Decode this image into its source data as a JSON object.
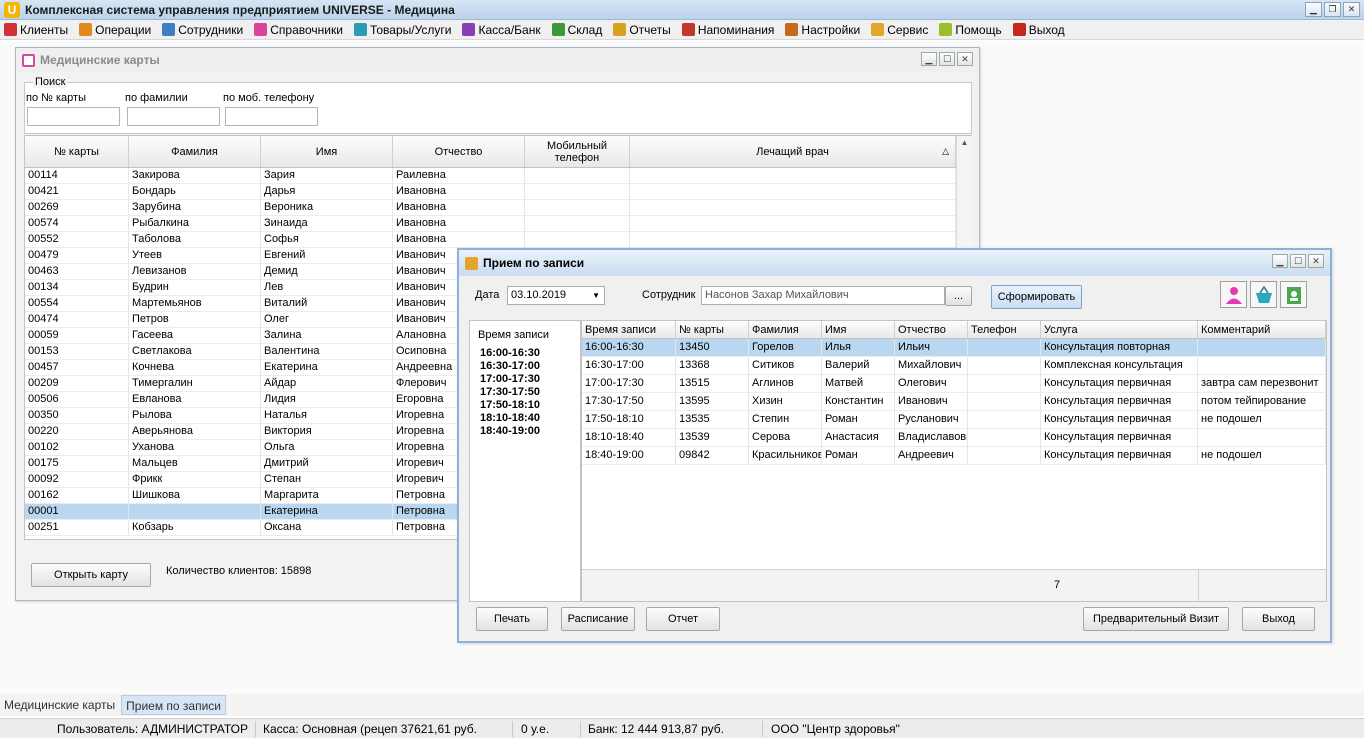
{
  "app": {
    "title": "Комплексная система управления предприятием UNIVERSE - Медицина",
    "logo_letter": "U"
  },
  "menu": [
    {
      "label": "Клиенты",
      "icon": "clients-icon",
      "color": "#d0323a"
    },
    {
      "label": "Операции",
      "icon": "operations-icon",
      "color": "#e08a1e"
    },
    {
      "label": "Сотрудники",
      "icon": "employees-icon",
      "color": "#3f7fc1"
    },
    {
      "label": "Справочники",
      "icon": "references-icon",
      "color": "#d9449a"
    },
    {
      "label": "Товары/Услуги",
      "icon": "goods-icon",
      "color": "#2e9ab5"
    },
    {
      "label": "Касса/Банк",
      "icon": "cash-icon",
      "color": "#8a3fb3"
    },
    {
      "label": "Склад",
      "icon": "warehouse-icon",
      "color": "#3a9a3a"
    },
    {
      "label": "Отчеты",
      "icon": "reports-icon",
      "color": "#d7a21e"
    },
    {
      "label": "Напоминания",
      "icon": "clock-icon",
      "color": "#c0392b"
    },
    {
      "label": "Настройки",
      "icon": "gear-icon",
      "color": "#c56a1a"
    },
    {
      "label": "Сервис",
      "icon": "service-icon",
      "color": "#e0a82a"
    },
    {
      "label": "Помощь",
      "icon": "help-icon",
      "color": "#9bbf2a"
    },
    {
      "label": "Выход",
      "icon": "exit-icon",
      "color": "#c7261f"
    }
  ],
  "cards_window": {
    "title": "Медицинские карты",
    "search": {
      "legend": "Поиск",
      "by_card": "по № карты",
      "by_surname": "по фамилии",
      "by_phone": "по моб. телефону"
    },
    "columns": [
      "№ карты",
      "Фамилия",
      "Имя",
      "Отчество",
      "Мобильный телефон",
      "Лечащий врач"
    ],
    "sort_indicator": "△",
    "rows": [
      [
        "00114",
        "Закирова",
        "Зария",
        "Раилевна"
      ],
      [
        "00421",
        "Бондарь",
        "Дарья",
        "Ивановна"
      ],
      [
        "00269",
        "Зарубина",
        "Вероника",
        "Ивановна"
      ],
      [
        "00574",
        "Рыбалкина",
        "Зинаида",
        "Ивановна"
      ],
      [
        "00552",
        "Таболова",
        "Софья",
        "Ивановна"
      ],
      [
        "00479",
        "Утеев",
        "Евгений",
        "Иванович"
      ],
      [
        "00463",
        "Левизанов",
        "Демид",
        "Иванович"
      ],
      [
        "00134",
        "Будрин",
        "Лев",
        "Иванович"
      ],
      [
        "00554",
        "Мартемьянов",
        "Виталий",
        "Иванович"
      ],
      [
        "00474",
        "Петров",
        "Олег",
        "Иванович"
      ],
      [
        "00059",
        "Гасеева",
        "Залина",
        "Алановна"
      ],
      [
        "00153",
        "Светлакова",
        "Валентина",
        "Осиповна"
      ],
      [
        "00457",
        "Кочнева",
        "Екатерина",
        "Андреевна"
      ],
      [
        "00209",
        "Тимергалин",
        "Айдар",
        "Флерович"
      ],
      [
        "00506",
        "Евланова",
        "Лидия",
        "Егоровна"
      ],
      [
        "00350",
        "Рылова",
        "Наталья",
        "Игоревна"
      ],
      [
        "00220",
        "Аверьянова",
        "Виктория",
        "Игоревна"
      ],
      [
        "00102",
        "Уханова",
        "Ольга",
        "Игоревна"
      ],
      [
        "00175",
        "Мальцев",
        "Дмитрий",
        "Игоревич"
      ],
      [
        "00092",
        "Фрикк",
        "Степан",
        "Игоревич"
      ],
      [
        "00162",
        "Шишкова",
        "Маргарита",
        "Петровна"
      ],
      [
        "00001",
        "",
        "Екатерина",
        "Петровна"
      ],
      [
        "00251",
        "Кобзарь",
        "Оксана",
        "Петровна"
      ]
    ],
    "selected_row": 21,
    "open_button": "Открыть карту",
    "count_label": "Количество клиентов: 15898"
  },
  "appt_window": {
    "title": "Прием по записи",
    "date_label": "Дата",
    "date_value": "03.10.2019",
    "employee_label": "Сотрудник",
    "employee_value": "Насонов Захар Михайлович",
    "browse_label": "...",
    "generate_button": "Сформировать",
    "slots_title": "Время записи",
    "slots": [
      "16:00-16:30",
      "16:30-17:00",
      "17:00-17:30",
      "17:30-17:50",
      "17:50-18:10",
      "18:10-18:40",
      "18:40-19:00"
    ],
    "columns": [
      "Время записи",
      "№ карты",
      "Фамилия",
      "Имя",
      "Отчество",
      "Телефон",
      "Услуга",
      "Комментарий"
    ],
    "rows": [
      [
        "16:00-16:30",
        "13450",
        "Горелов",
        "Илья",
        "Ильич",
        "",
        "Консультация повторная",
        ""
      ],
      [
        "16:30-17:00",
        "13368",
        "Ситиков",
        "Валерий",
        "Михайлович",
        "",
        "Комплексная консультация",
        ""
      ],
      [
        "17:00-17:30",
        "13515",
        "Аглинов",
        "Матвей",
        "Олегович",
        "",
        "Консультация первичная",
        "завтра сам перезвонит"
      ],
      [
        "17:30-17:50",
        "13595",
        "Хизин",
        "Константин",
        "Иванович",
        "",
        "Консультация первичная",
        "потом тейпирование"
      ],
      [
        "17:50-18:10",
        "13535",
        "Степин",
        "Роман",
        "Русланович",
        "",
        "Консультация первичная",
        "не подошел"
      ],
      [
        "18:10-18:40",
        "13539",
        "Серова",
        "Анастасия",
        "Владиславовна",
        "",
        "Консультация первичная",
        ""
      ],
      [
        "18:40-19:00",
        "09842",
        "Красильников",
        "Роман",
        "Андреевич",
        "",
        "Консультация первичная",
        "не подошел"
      ]
    ],
    "selected_row": 0,
    "footer_count": "7",
    "buttons": {
      "print": "Печать",
      "schedule": "Расписание",
      "report": "Отчет",
      "pre_visit": "Предварительный Визит",
      "exit": "Выход"
    }
  },
  "tabs": [
    "Медицинские карты",
    "Прием по записи"
  ],
  "active_tab": 1,
  "status": {
    "user": "Пользователь: АДМИНИСТРАТОР",
    "cash": "Касса: Основная (рецеп 37621,61 руб.",
    "ue": "0 у.е.",
    "bank_label": "Банк:",
    "bank_value": "12 444 913,87 руб.",
    "org": "ООО \"Центр здоровья\""
  }
}
